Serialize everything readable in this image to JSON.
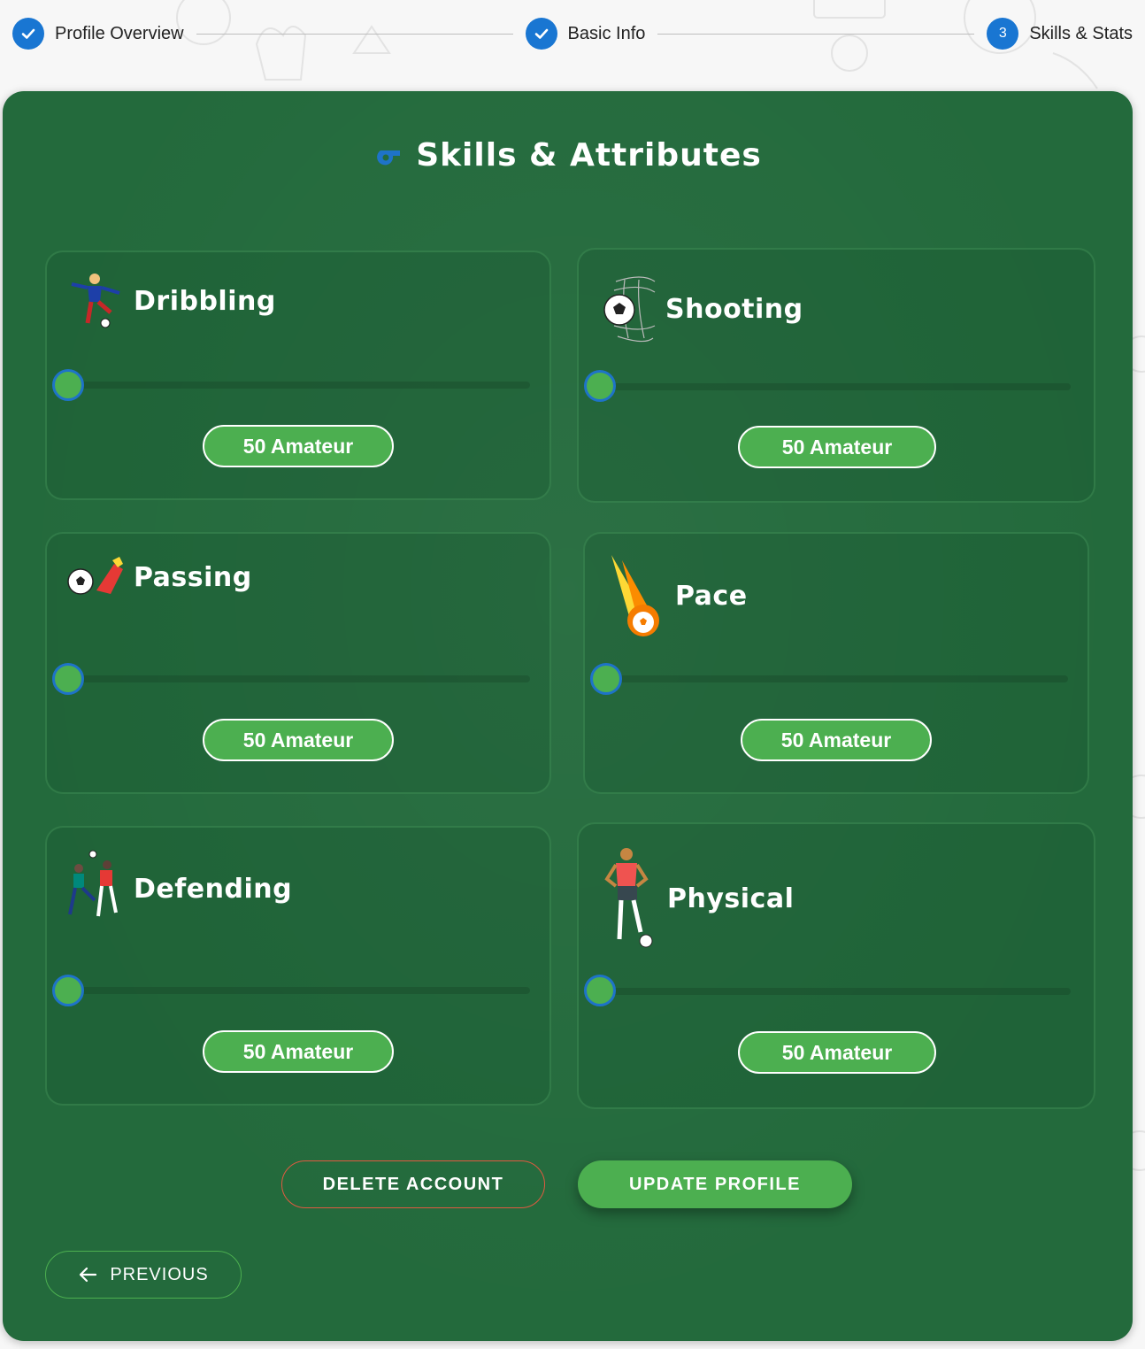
{
  "stepper": {
    "steps": [
      {
        "label": "Profile Overview",
        "state": "completed",
        "icon": "check-icon"
      },
      {
        "label": "Basic Info",
        "state": "completed",
        "icon": "check-icon"
      },
      {
        "label": "Skills & Stats",
        "state": "active",
        "number": "3"
      }
    ]
  },
  "header": {
    "title": "Skills & Attributes",
    "title_icon": "whistle-icon"
  },
  "skills": [
    {
      "name": "Dribbling",
      "icon": "dribbling-player-icon",
      "value": 50,
      "level": "50 Amateur"
    },
    {
      "name": "Shooting",
      "icon": "ball-in-net-icon",
      "value": 50,
      "level": "50 Amateur"
    },
    {
      "name": "Passing",
      "icon": "ball-and-boot-icon",
      "value": 50,
      "level": "50 Amateur"
    },
    {
      "name": "Pace",
      "icon": "fireball-icon",
      "value": 50,
      "level": "50 Amateur"
    },
    {
      "name": "Defending",
      "icon": "tackle-players-icon",
      "value": 50,
      "level": "50 Amateur"
    },
    {
      "name": "Physical",
      "icon": "strong-player-icon",
      "value": 50,
      "level": "50 Amateur"
    }
  ],
  "actions": {
    "delete_label": "DELETE ACCOUNT",
    "update_label": "UPDATE PROFILE",
    "previous_label": "PREVIOUS"
  },
  "colors": {
    "card_bg": "#236a3c",
    "accent_green": "#4caf50",
    "step_blue": "#1976d2",
    "delete_border": "#e05a40"
  }
}
